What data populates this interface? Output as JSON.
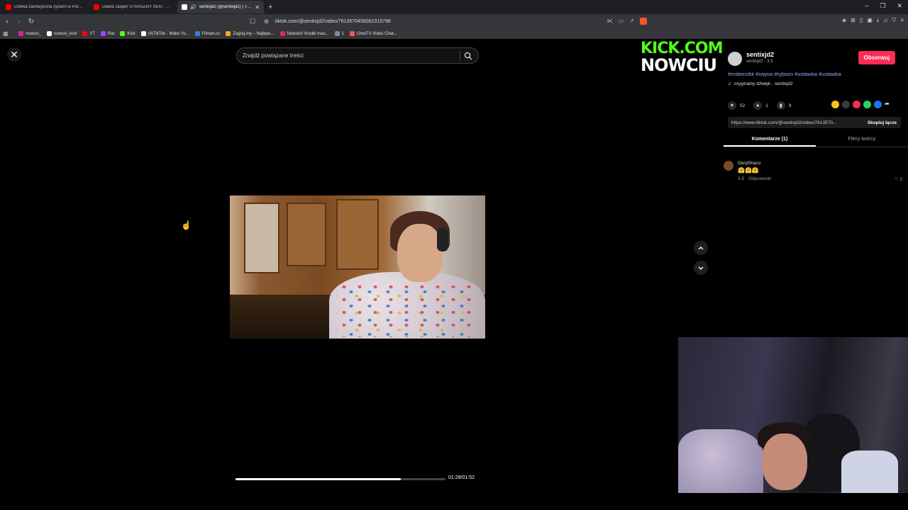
{
  "browser": {
    "tabs": [
      {
        "title": "Chinka zachwycona życiem w Polsce",
        "fav": "#ff0000",
        "active": false
      },
      {
        "title": "Dawid Jasper STRASZNY SEN - MAFI...",
        "fav": "#ff0000",
        "active": false
      },
      {
        "title": "sentixjd2 (@sentixjd2) | TikTok",
        "fav": "#ffffff",
        "active": true
      }
    ],
    "new_tab_label": "+",
    "url": "tiktok.com/@sentixjd2/video/7613570456062315798",
    "bookmarks": [
      {
        "label": "nowciu_",
        "fav": "#d6249f"
      },
      {
        "label": "nowciu_kick",
        "fav": "#ffffff"
      },
      {
        "label": "YT",
        "fav": "#ff0000"
      },
      {
        "label": "Rat",
        "fav": "#9146ff"
      },
      {
        "label": "Kick",
        "fav": "#53fc18"
      },
      {
        "label": "(4)TikTok - Make Yo...",
        "fav": "#ffffff"
      },
      {
        "label": "Filman.cc",
        "fav": "#3a7bd5"
      },
      {
        "label": "Zagraj.my – Najleps...",
        "fav": "#f5a623"
      },
      {
        "label": "Nowość! Kostki mas...",
        "fav": "#e91e63"
      },
      {
        "label": "1",
        "fav": "#888888"
      },
      {
        "label": "OmeTV Video Chat...",
        "fav": "#ff5252"
      }
    ]
  },
  "video": {
    "search_placeholder": "Znajdź powiązane treści",
    "time": "01:28/01:52",
    "progress": 0.787
  },
  "overlay": {
    "kick_line1": "KICK.COM",
    "kick_line2": "NOWCIU"
  },
  "panel": {
    "username": "sentixjd2",
    "sub": "sentixjd2 · 3-5",
    "follow_label": "Obserwuj",
    "hashtags": "#rrobercikk #xayoo #rybson #ustawka #ustawka",
    "sound": "oryginalny dźwięk - sentixjd2",
    "likes": "52",
    "comments": "1",
    "saves": "9",
    "link": "https://www.tiktok.com/@sentixjd2/video/7613570...",
    "copy_label": "Skopiuj łącze",
    "tab_comments": "Komentarze (1)",
    "tab_creator": "Filmy twórcy",
    "comment": {
      "author": "DerpShaco",
      "text": "🤗🤗🤗",
      "date": "3-5",
      "reply": "Odpowiedz",
      "likes": "2"
    }
  },
  "colors": {
    "accent": "#fe2c55",
    "kick_green": "#53fc18",
    "link_blue": "#8ab4f8"
  }
}
